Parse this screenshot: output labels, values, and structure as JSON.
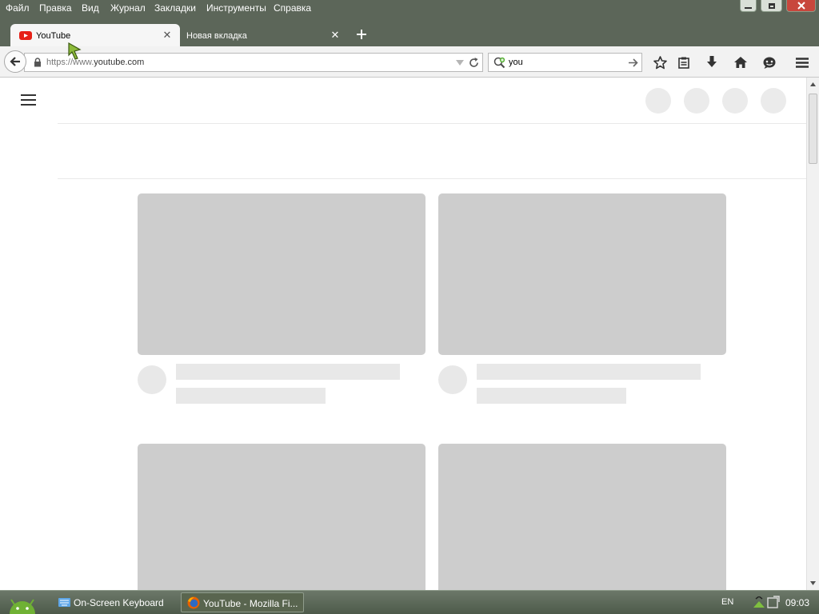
{
  "menu": [
    "Файл",
    "Правка",
    "Вид",
    "Журнал",
    "Закладки",
    "Инструменты",
    "Справка"
  ],
  "tabs": [
    {
      "title": "YouTube",
      "active": true
    },
    {
      "title": "Новая вкладка",
      "active": false
    }
  ],
  "address": {
    "scheme": "https://www.",
    "host": "youtube.com"
  },
  "search": {
    "value": "you"
  },
  "toolbar_icons": [
    "star-icon",
    "reading-list-icon",
    "download-icon",
    "home-icon",
    "chat-icon",
    "hamburger-menu-icon"
  ],
  "taskbar": {
    "items": [
      {
        "label": "On-Screen Keyboard",
        "icon": "keyboard-icon"
      },
      {
        "label": "YouTube - Mozilla Fi...",
        "icon": "firefox-icon"
      }
    ],
    "language": "EN",
    "clock": "09:03"
  },
  "colors": {
    "chrome": "#5c6659",
    "placeholder": "#cdcdcd",
    "youtube_red": "#e62117"
  }
}
